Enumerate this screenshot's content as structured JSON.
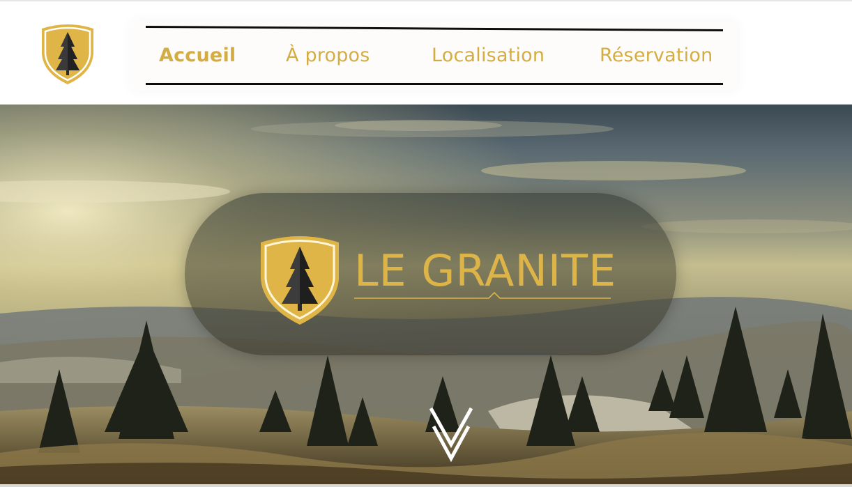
{
  "header": {
    "logo_icon": "tree-shield-icon",
    "nav": {
      "items": [
        {
          "label": "Accueil",
          "active": true
        },
        {
          "label": "À propos",
          "active": false
        },
        {
          "label": "Localisation",
          "active": false
        },
        {
          "label": "Réservation",
          "active": false
        }
      ]
    }
  },
  "hero": {
    "brand_name": "LE GRANITE",
    "brand_logo_icon": "tree-shield-icon",
    "scroll_icon": "double-chevron-down-icon"
  },
  "colors": {
    "gold": "#d4ad42",
    "brand_gold": "#dcb448",
    "dark_tree": "#2b2b2b",
    "nav_line": "#0e0e0e"
  }
}
